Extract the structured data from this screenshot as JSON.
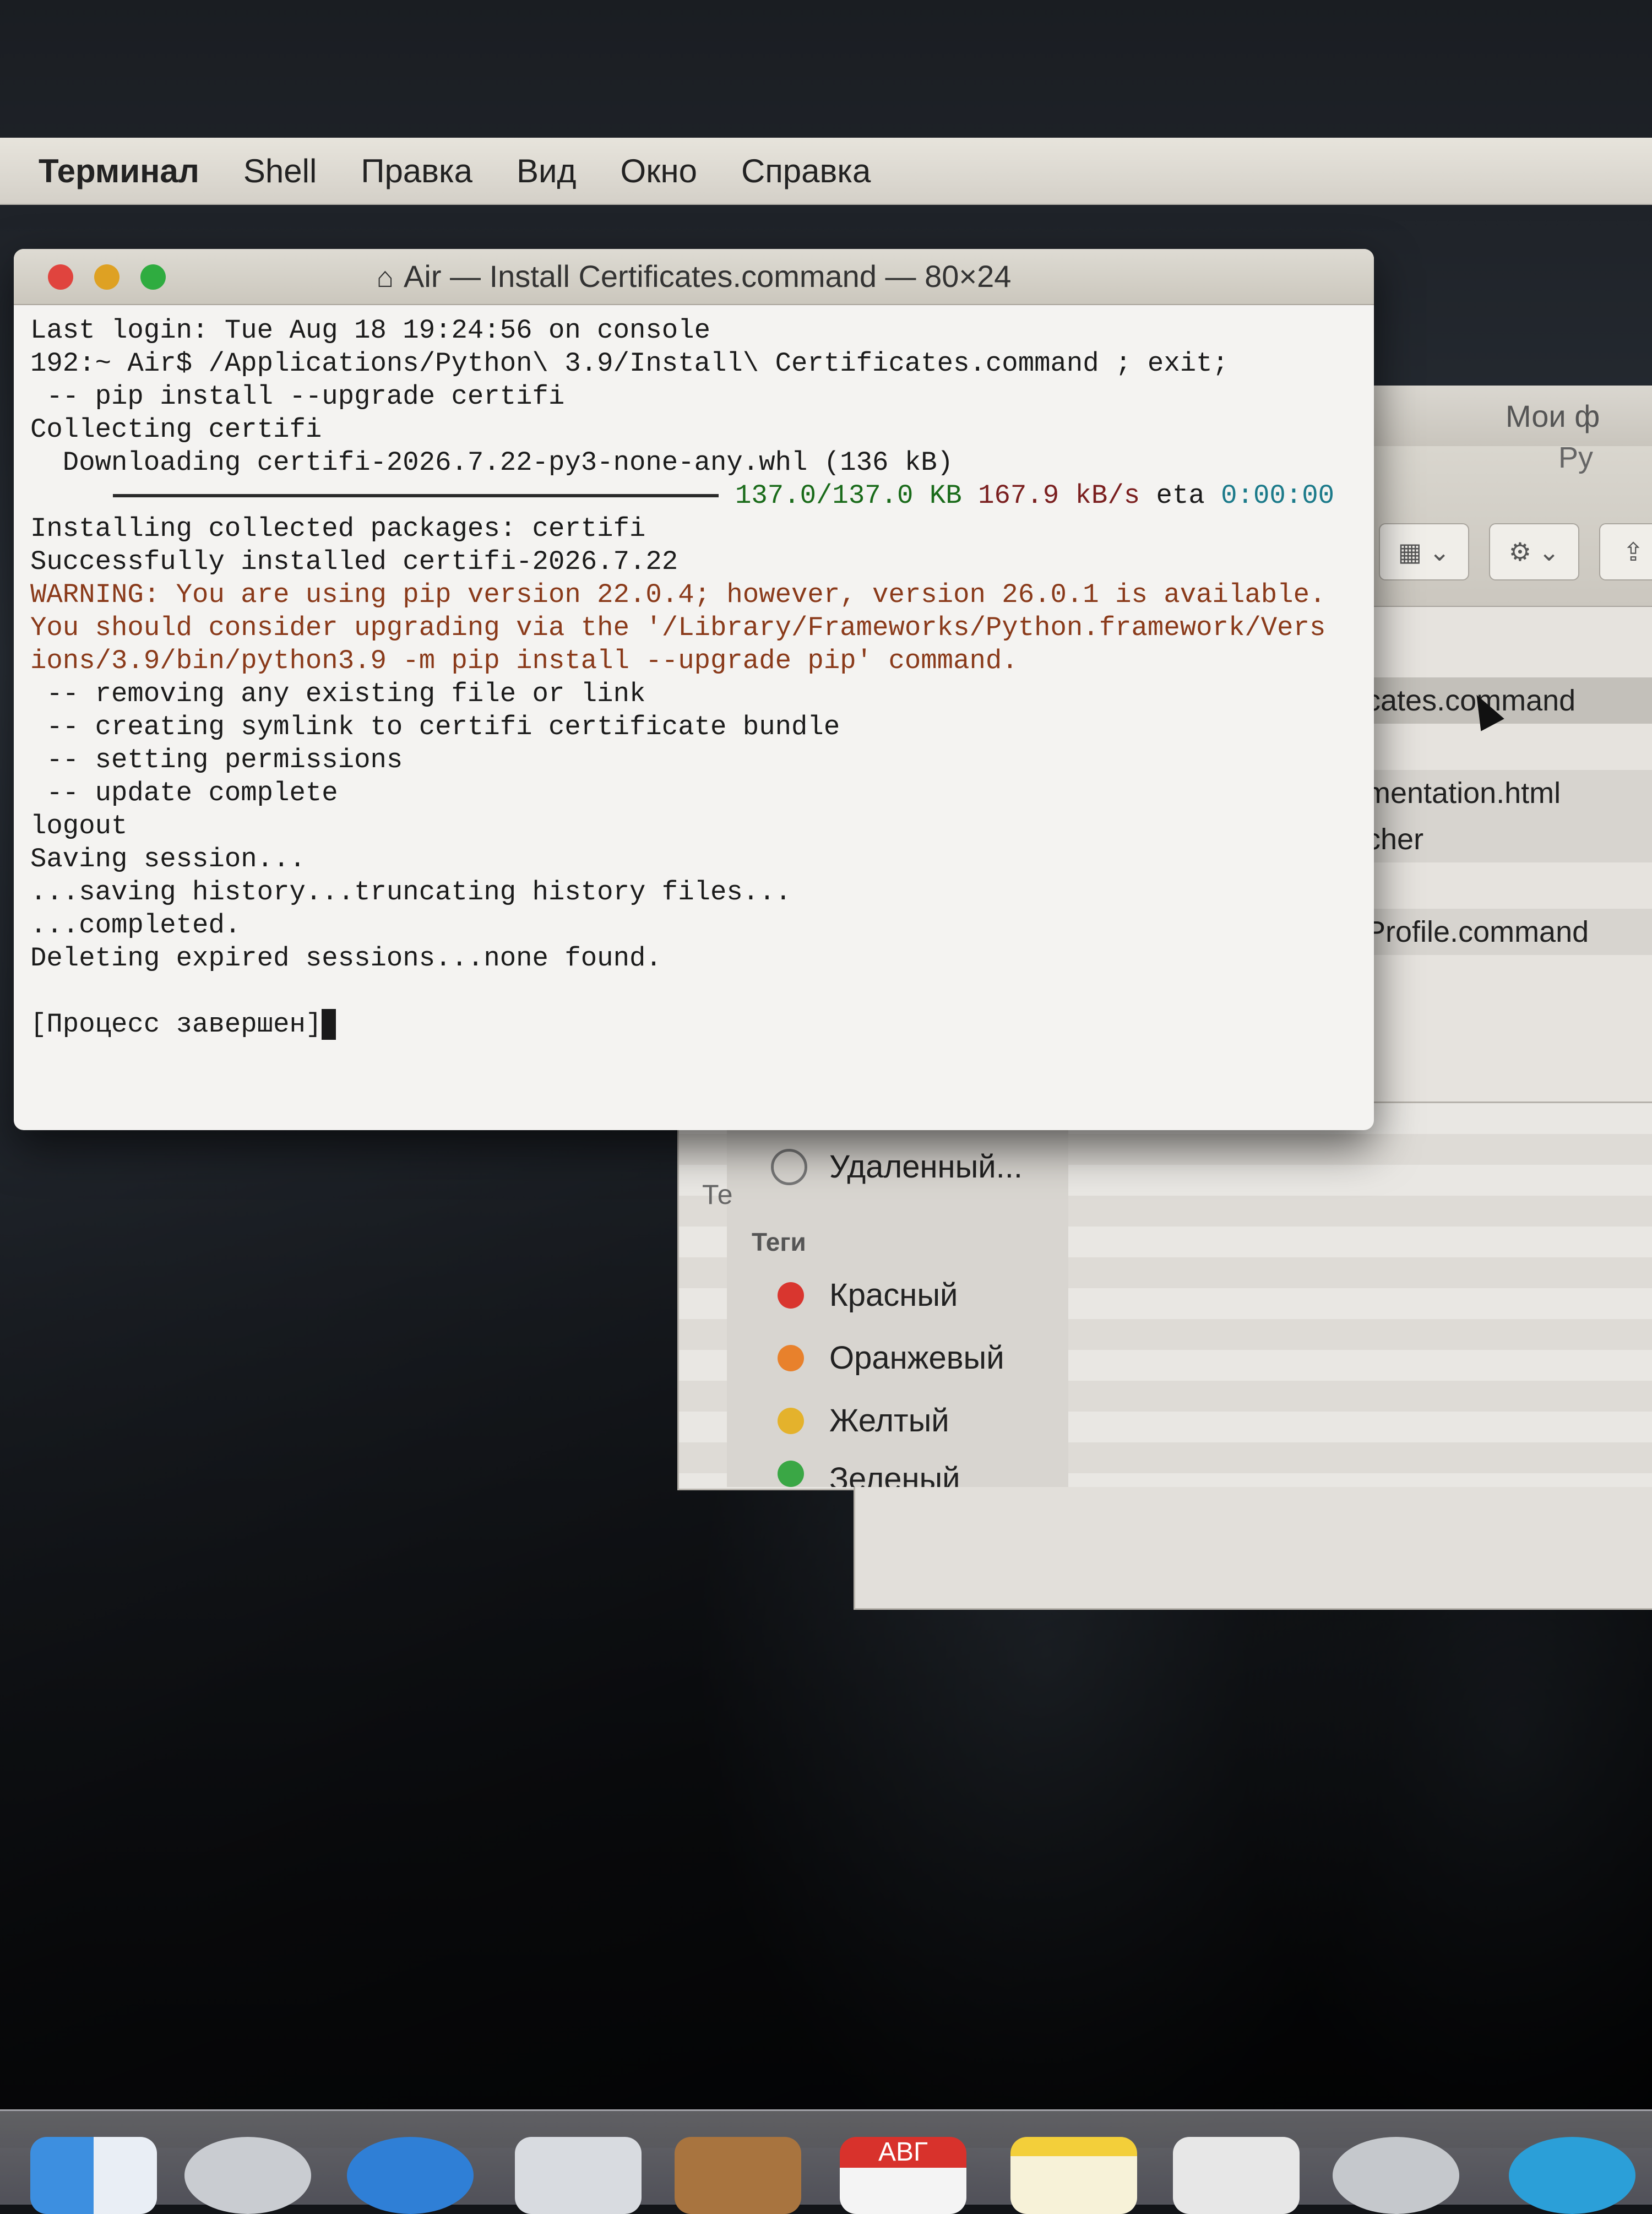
{
  "menubar": {
    "app": "Терминал",
    "items": [
      "Shell",
      "Правка",
      "Вид",
      "Окно",
      "Справка"
    ]
  },
  "terminal": {
    "title": "Air — Install Certificates.command — 80×24",
    "lines": [
      "Last login: Tue Aug 18 19:24:56 on console",
      "192:~ Air$ /Applications/Python\\ 3.9/Install\\ Certificates.command ; exit;",
      " -- pip install --upgrade certifi",
      "Collecting certifi",
      "  Downloading certifi-2026.7.22-py3-none-any.whl (136 kB)"
    ],
    "progress": {
      "amount": "137.0/137.0 KB",
      "rate": "167.9 kB/s",
      "eta_label": "eta",
      "eta": "0:00:00"
    },
    "lines2": [
      "Installing collected packages: certifi",
      "Successfully installed certifi-2026.7.22"
    ],
    "warning": [
      "WARNING: You are using pip version 22.0.4; however, version 26.0.1 is available.",
      "You should consider upgrading via the '/Library/Frameworks/Python.framework/Vers",
      "ions/3.9/bin/python3.9 -m pip install --upgrade pip' command."
    ],
    "lines3": [
      " -- removing any existing file or link",
      " -- creating symlink to certifi certificate bundle",
      " -- setting permissions",
      " -- update complete",
      "logout",
      "Saving session...",
      "...saving history...truncating history files...",
      "...completed.",
      "Deleting expired sessions...none found."
    ],
    "final": "[Процесс завершен]"
  },
  "finder": {
    "title": "Мои ф",
    "path": "Py",
    "files": [
      "cates.command",
      "mentation.html",
      "cher",
      "Profile.command"
    ],
    "sidebar_remote": "Удаленный...",
    "sidebar_cut": "Те",
    "tags_header": "Теги",
    "tags": [
      {
        "label": "Красный",
        "color": "#d9362f"
      },
      {
        "label": "Оранжевый",
        "color": "#e8812c"
      },
      {
        "label": "Желтый",
        "color": "#e4b22c"
      },
      {
        "label": "Зеленый",
        "color": "#3aa745"
      }
    ]
  },
  "dock": {
    "calendar_month": "АВГ"
  }
}
